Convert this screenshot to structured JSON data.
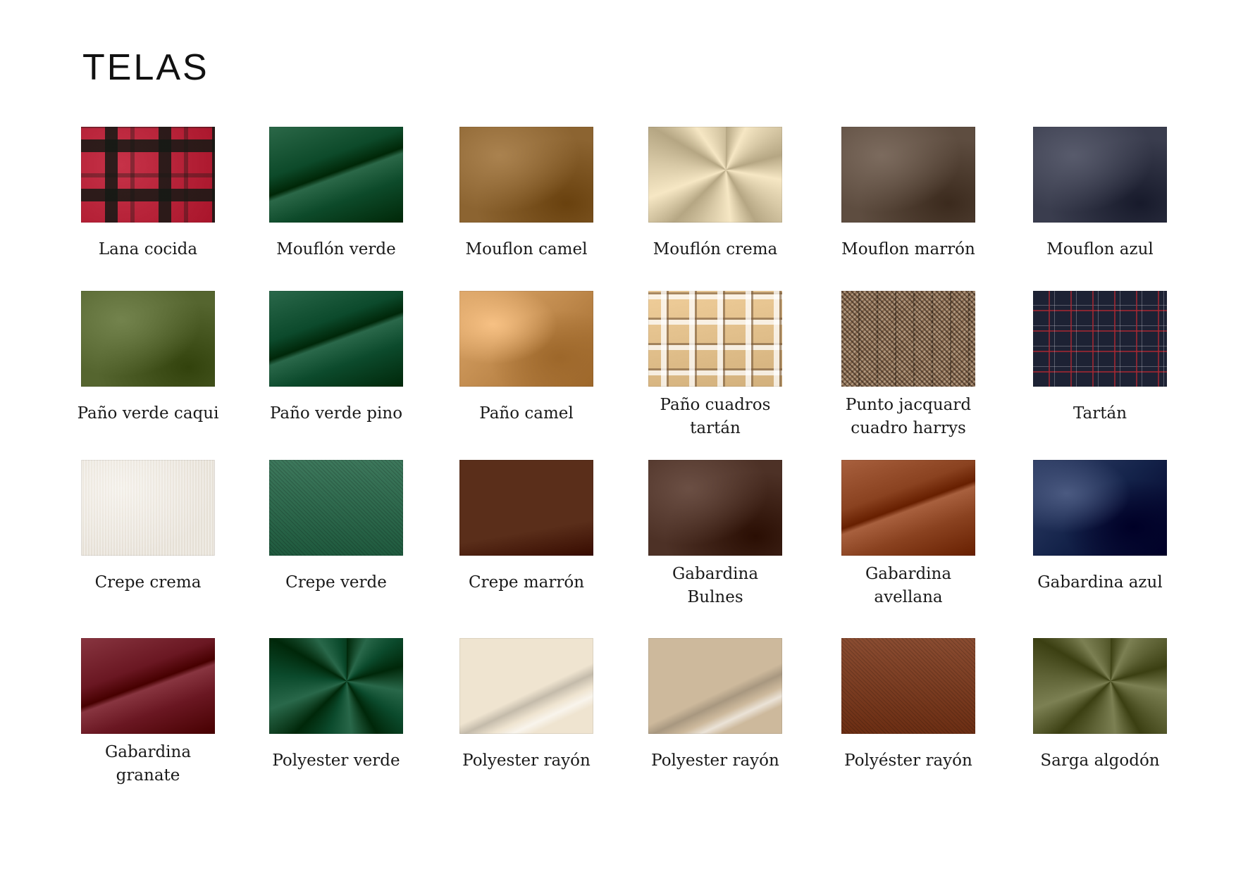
{
  "page": {
    "title": "TELAS"
  },
  "swatches": [
    {
      "label": "Lana cocida",
      "color": "#a8142a",
      "pattern": "plaid-red"
    },
    {
      "label": "Mouflón verde",
      "color": "#0d4a2a",
      "pattern": "fold"
    },
    {
      "label": "Mouflon camel",
      "color": "#8c6431",
      "pattern": "felt"
    },
    {
      "label": "Mouflón crema",
      "color": "#d8c9a6",
      "pattern": "twist"
    },
    {
      "label": "Mouflon marrón",
      "color": "#5e4d40",
      "pattern": "felt"
    },
    {
      "label": "Mouflon azul",
      "color": "#3a3d4e",
      "pattern": "felt"
    },
    {
      "label": "Paño verde caqui",
      "color": "#55652f",
      "pattern": "felt"
    },
    {
      "label": "Paño verde pino",
      "color": "#0c4a2c",
      "pattern": "fold"
    },
    {
      "label": "Paño camel",
      "color": "#c08a4d",
      "pattern": "drape"
    },
    {
      "label": "Paño cuadros\ntartán",
      "color": "#d2b07c",
      "pattern": "plaid-beige"
    },
    {
      "label": "Punto jacquard\ncuadro harrys",
      "color": "#8a6c52",
      "pattern": "houndstooth"
    },
    {
      "label": "Tartán",
      "color": "#1d2234",
      "pattern": "plaid-navy"
    },
    {
      "label": "Crepe crema",
      "color": "#e6e0d6",
      "pattern": "knit"
    },
    {
      "label": "Crepe verde",
      "color": "#1f5a3e",
      "pattern": "twill"
    },
    {
      "label": "Crepe marrón",
      "color": "#5a2e1a",
      "pattern": "sheen"
    },
    {
      "label": "Gabardina\nBulnes",
      "color": "#4d3126",
      "pattern": "felt"
    },
    {
      "label": "Gabardina\navellana",
      "color": "#8a4220",
      "pattern": "fold"
    },
    {
      "label": "Gabardina azul",
      "color": "#14234a",
      "pattern": "drape"
    },
    {
      "label": "Gabardina\ngranate",
      "color": "#6a1722",
      "pattern": "fold"
    },
    {
      "label": "Polyester verde",
      "color": "#0b4a2c",
      "pattern": "twist"
    },
    {
      "label": "Polyester rayón",
      "color": "#efe4d0",
      "pattern": "sheen-light"
    },
    {
      "label": "Polyester rayón",
      "color": "#cdb99c",
      "pattern": "sheen-light"
    },
    {
      "label": "Polyéster rayón",
      "color": "#6c2e13",
      "pattern": "twill"
    },
    {
      "label": "Sarga algodón",
      "color": "#5e6235",
      "pattern": "twist"
    }
  ]
}
